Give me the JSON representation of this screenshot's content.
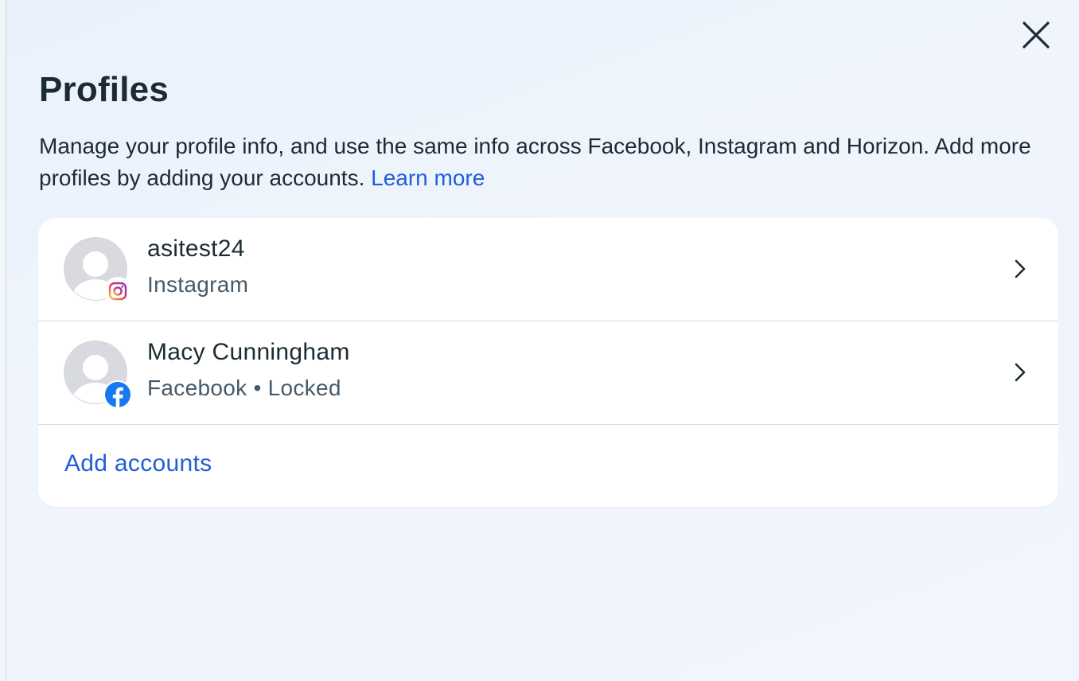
{
  "page": {
    "title": "Profiles",
    "description": "Manage your profile info, and use the same info across Facebook, Instagram and Horizon. Add more profiles by adding your accounts.",
    "learn_more": "Learn more",
    "close_icon": "close-icon"
  },
  "profiles": [
    {
      "name": "asitest24",
      "subtitle": "Instagram",
      "avatar_icon": "default-avatar-icon",
      "badge_icon": "instagram-icon",
      "badge_colors": [
        "#f9c84a",
        "#e1306c",
        "#833ab4"
      ]
    },
    {
      "name": "Macy Cunningham",
      "subtitle": "Facebook • Locked",
      "avatar_icon": "default-avatar-icon",
      "badge_icon": "facebook-icon",
      "badge_color": "#1877f2"
    }
  ],
  "actions": {
    "add_accounts": "Add accounts"
  },
  "colors": {
    "link": "#1f5fd8",
    "text": "#1c2b33",
    "secondary_text": "#465a69"
  }
}
